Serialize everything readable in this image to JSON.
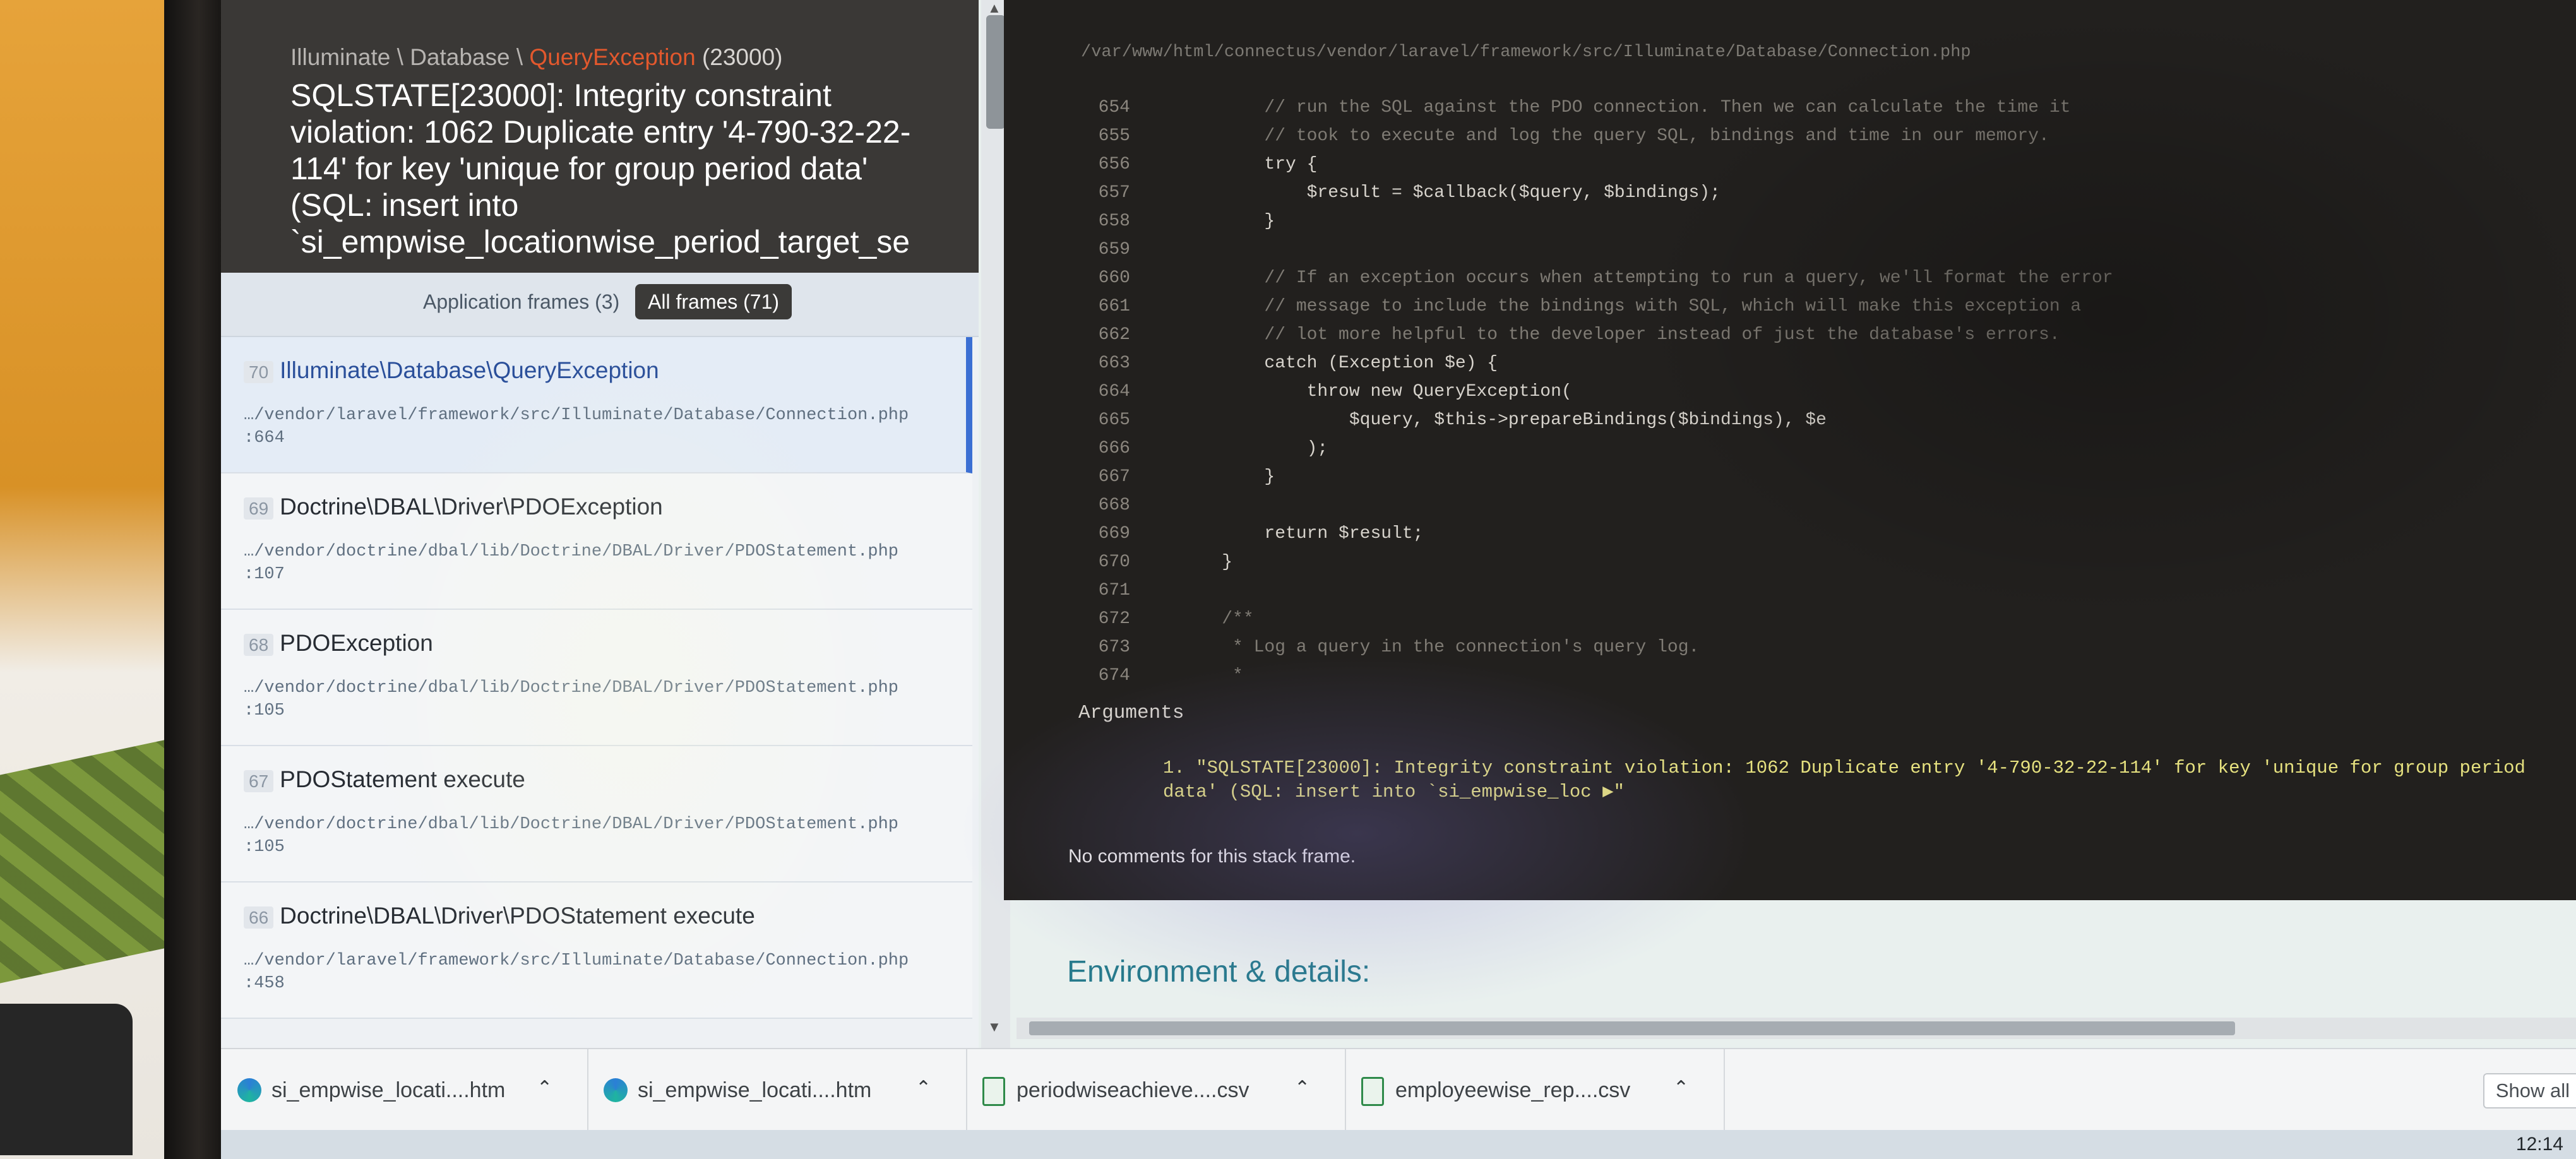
{
  "exception": {
    "namespace": "Illuminate \\ Database \\ ",
    "class": "QueryException",
    "code": "(23000)",
    "message": "SQLSTATE[23000]: Integrity constraint violation: 1062 Duplicate entry '4-790-32-22-114' for key 'unique for group period data' (SQL: insert into `si_empwise_locationwise_period_target_se"
  },
  "frame_tabs": {
    "application": "Application frames (3)",
    "all": "All frames (71)"
  },
  "frames": [
    {
      "num": "70",
      "title": "Illuminate\\Database\\QueryException",
      "file": "…/vendor/laravel/framework/src/Illuminate/Database/Connection.php",
      "line": ":664"
    },
    {
      "num": "69",
      "title": "Doctrine\\DBAL\\Driver\\PDOException",
      "file": "…/vendor/doctrine/dbal/lib/Doctrine/DBAL/Driver/PDOStatement.php",
      "line": ":107"
    },
    {
      "num": "68",
      "title": "PDOException",
      "file": "…/vendor/doctrine/dbal/lib/Doctrine/DBAL/Driver/PDOStatement.php",
      "line": ":105"
    },
    {
      "num": "67",
      "title": "PDOStatement execute",
      "file": "…/vendor/doctrine/dbal/lib/Doctrine/DBAL/Driver/PDOStatement.php",
      "line": ":105"
    },
    {
      "num": "66",
      "title": "Doctrine\\DBAL\\Driver\\PDOStatement execute",
      "file": "…/vendor/laravel/framework/src/Illuminate/Database/Connection.php",
      "line": ":458"
    }
  ],
  "code_view": {
    "path": "/var/www/html/connectus/vendor/laravel/framework/src/Illuminate/Database/Connection.php",
    "lines": [
      {
        "n": "654",
        "text": "        // run the SQL against the PDO connection. Then we can calculate the time it",
        "kind": "comment"
      },
      {
        "n": "655",
        "text": "        // took to execute and log the query SQL, bindings and time in our memory.",
        "kind": "comment"
      },
      {
        "n": "656",
        "text": "        try {",
        "kind": "code"
      },
      {
        "n": "657",
        "text": "            $result = $callback($query, $bindings);",
        "kind": "code"
      },
      {
        "n": "658",
        "text": "        }",
        "kind": "code"
      },
      {
        "n": "659",
        "text": "",
        "kind": "code"
      },
      {
        "n": "660",
        "text": "        // If an exception occurs when attempting to run a query, we'll format the error",
        "kind": "comment"
      },
      {
        "n": "661",
        "text": "        // message to include the bindings with SQL, which will make this exception a",
        "kind": "comment"
      },
      {
        "n": "662",
        "text": "        // lot more helpful to the developer instead of just the database's errors.",
        "kind": "comment"
      },
      {
        "n": "663",
        "text": "        catch (Exception $e) {",
        "kind": "code"
      },
      {
        "n": "664",
        "text": "            throw new QueryException(",
        "kind": "code"
      },
      {
        "n": "665",
        "text": "                $query, $this->prepareBindings($bindings), $e",
        "kind": "code"
      },
      {
        "n": "666",
        "text": "            );",
        "kind": "code"
      },
      {
        "n": "667",
        "text": "        }",
        "kind": "code"
      },
      {
        "n": "668",
        "text": "",
        "kind": "code"
      },
      {
        "n": "669",
        "text": "        return $result;",
        "kind": "code"
      },
      {
        "n": "670",
        "text": "    }",
        "kind": "code"
      },
      {
        "n": "671",
        "text": "",
        "kind": "code"
      },
      {
        "n": "672",
        "text": "    /**",
        "kind": "comment"
      },
      {
        "n": "673",
        "text": "     * Log a query in the connection's query log.",
        "kind": "comment"
      },
      {
        "n": "674",
        "text": "     *",
        "kind": "comment"
      }
    ]
  },
  "arguments": {
    "label": "Arguments",
    "index": "1.",
    "value": "\"SQLSTATE[23000]: Integrity constraint violation: 1062 Duplicate entry '4-790-32-22-114' for key 'unique for group period data' (SQL: insert into `si_empwise_loc ▶\""
  },
  "comments_note": "No comments for this stack frame.",
  "environment_heading": "Environment & details:",
  "downloads": [
    {
      "name": "si_empwise_locati....htm",
      "icon": "edge-icon"
    },
    {
      "name": "si_empwise_locati....htm",
      "icon": "edge-icon"
    },
    {
      "name": "periodwiseachieve....csv",
      "icon": "csv-file-icon"
    },
    {
      "name": "employeewise_rep....csv",
      "icon": "csv-file-icon"
    }
  ],
  "show_all": "Show all",
  "clock": "12:14",
  "colors": {
    "exception_class": "#e2582d",
    "active_frame_border": "#3b6fd3",
    "argument_text": "#e6e17f",
    "environment_heading": "#277a8c"
  }
}
